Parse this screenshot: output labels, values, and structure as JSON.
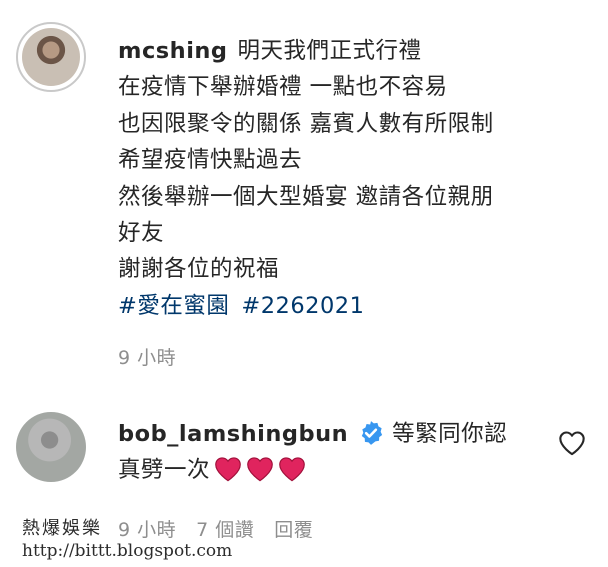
{
  "post": {
    "username": "mcshing",
    "caption_lines": [
      "明天我們正式行禮",
      "在疫情下舉辦婚禮 一點也不容易",
      "也因限聚令的關係 嘉賓人數有所限制",
      "希望疫情快點過去",
      "然後舉辦一個大型婚宴 邀請各位親朋",
      "好友",
      "謝謝各位的祝福"
    ],
    "hashtags": [
      "#愛在蜜園",
      "#2262021"
    ],
    "time": "9 小時"
  },
  "reply": {
    "username": "bob_lamshingbun",
    "verified": true,
    "text_line1": "等緊同你認",
    "text_line2": "真劈一次",
    "emoji": [
      "red-heart",
      "red-heart",
      "red-heart"
    ],
    "time": "9 小時",
    "likes": "7 個讚",
    "reply_label": "回覆"
  },
  "watermark": {
    "line1": "熱爆娛樂",
    "line2": "http://bittt.blogspot.com"
  },
  "colors": {
    "text": "#262626",
    "secondary": "#8e8e8e",
    "hashtag": "#00376b",
    "verified": "#3897f0",
    "heart": "#e0245e"
  }
}
